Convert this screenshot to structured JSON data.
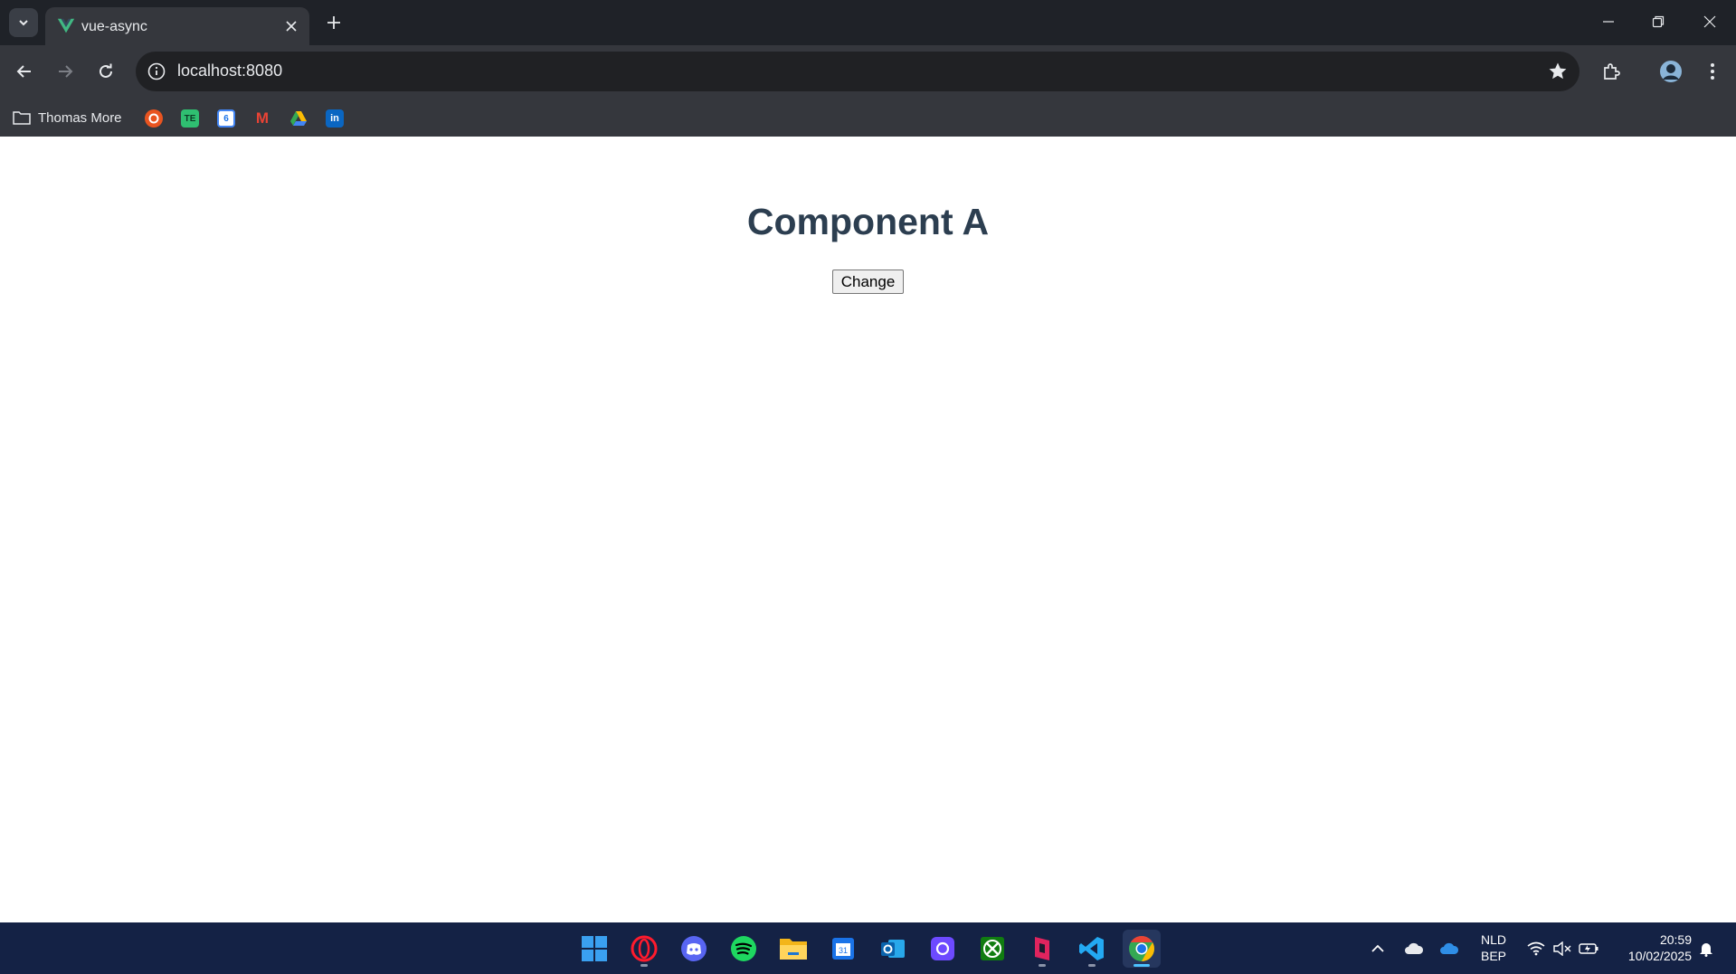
{
  "browser": {
    "tab": {
      "title": "vue-async"
    },
    "address": {
      "url": "localhost:8080"
    },
    "bookmarks": {
      "folder_label": "Thomas More",
      "items": [
        {
          "icon": "ubuntu-icon",
          "color": "#e95420"
        },
        {
          "icon": "tradingeconomics-icon",
          "label": "TE",
          "color": "#2fbf71"
        },
        {
          "icon": "google-calendar-icon",
          "label": "6",
          "color": "#4285f4"
        },
        {
          "icon": "gmail-icon",
          "label": "M",
          "color": "#ea4335"
        },
        {
          "icon": "google-drive-icon",
          "color": "#fbbc04"
        },
        {
          "icon": "linkedin-icon",
          "label": "in",
          "color": "#0a66c2"
        }
      ]
    }
  },
  "page": {
    "heading": "Component A",
    "button_label": "Change",
    "heading_color": "#2c3e50"
  },
  "taskbar": {
    "apps": [
      {
        "name": "windows-start-icon"
      },
      {
        "name": "opera-icon"
      },
      {
        "name": "discord-icon"
      },
      {
        "name": "spotify-icon"
      },
      {
        "name": "file-explorer-icon"
      },
      {
        "name": "calendar-icon"
      },
      {
        "name": "outlook-icon"
      },
      {
        "name": "proton-icon"
      },
      {
        "name": "xbox-icon"
      },
      {
        "name": "app-icon"
      },
      {
        "name": "vscode-icon"
      },
      {
        "name": "chrome-icon",
        "active": true
      }
    ],
    "language": {
      "line1": "NLD",
      "line2": "BEP"
    },
    "clock": {
      "time": "20:59",
      "date": "10/02/2025"
    }
  }
}
